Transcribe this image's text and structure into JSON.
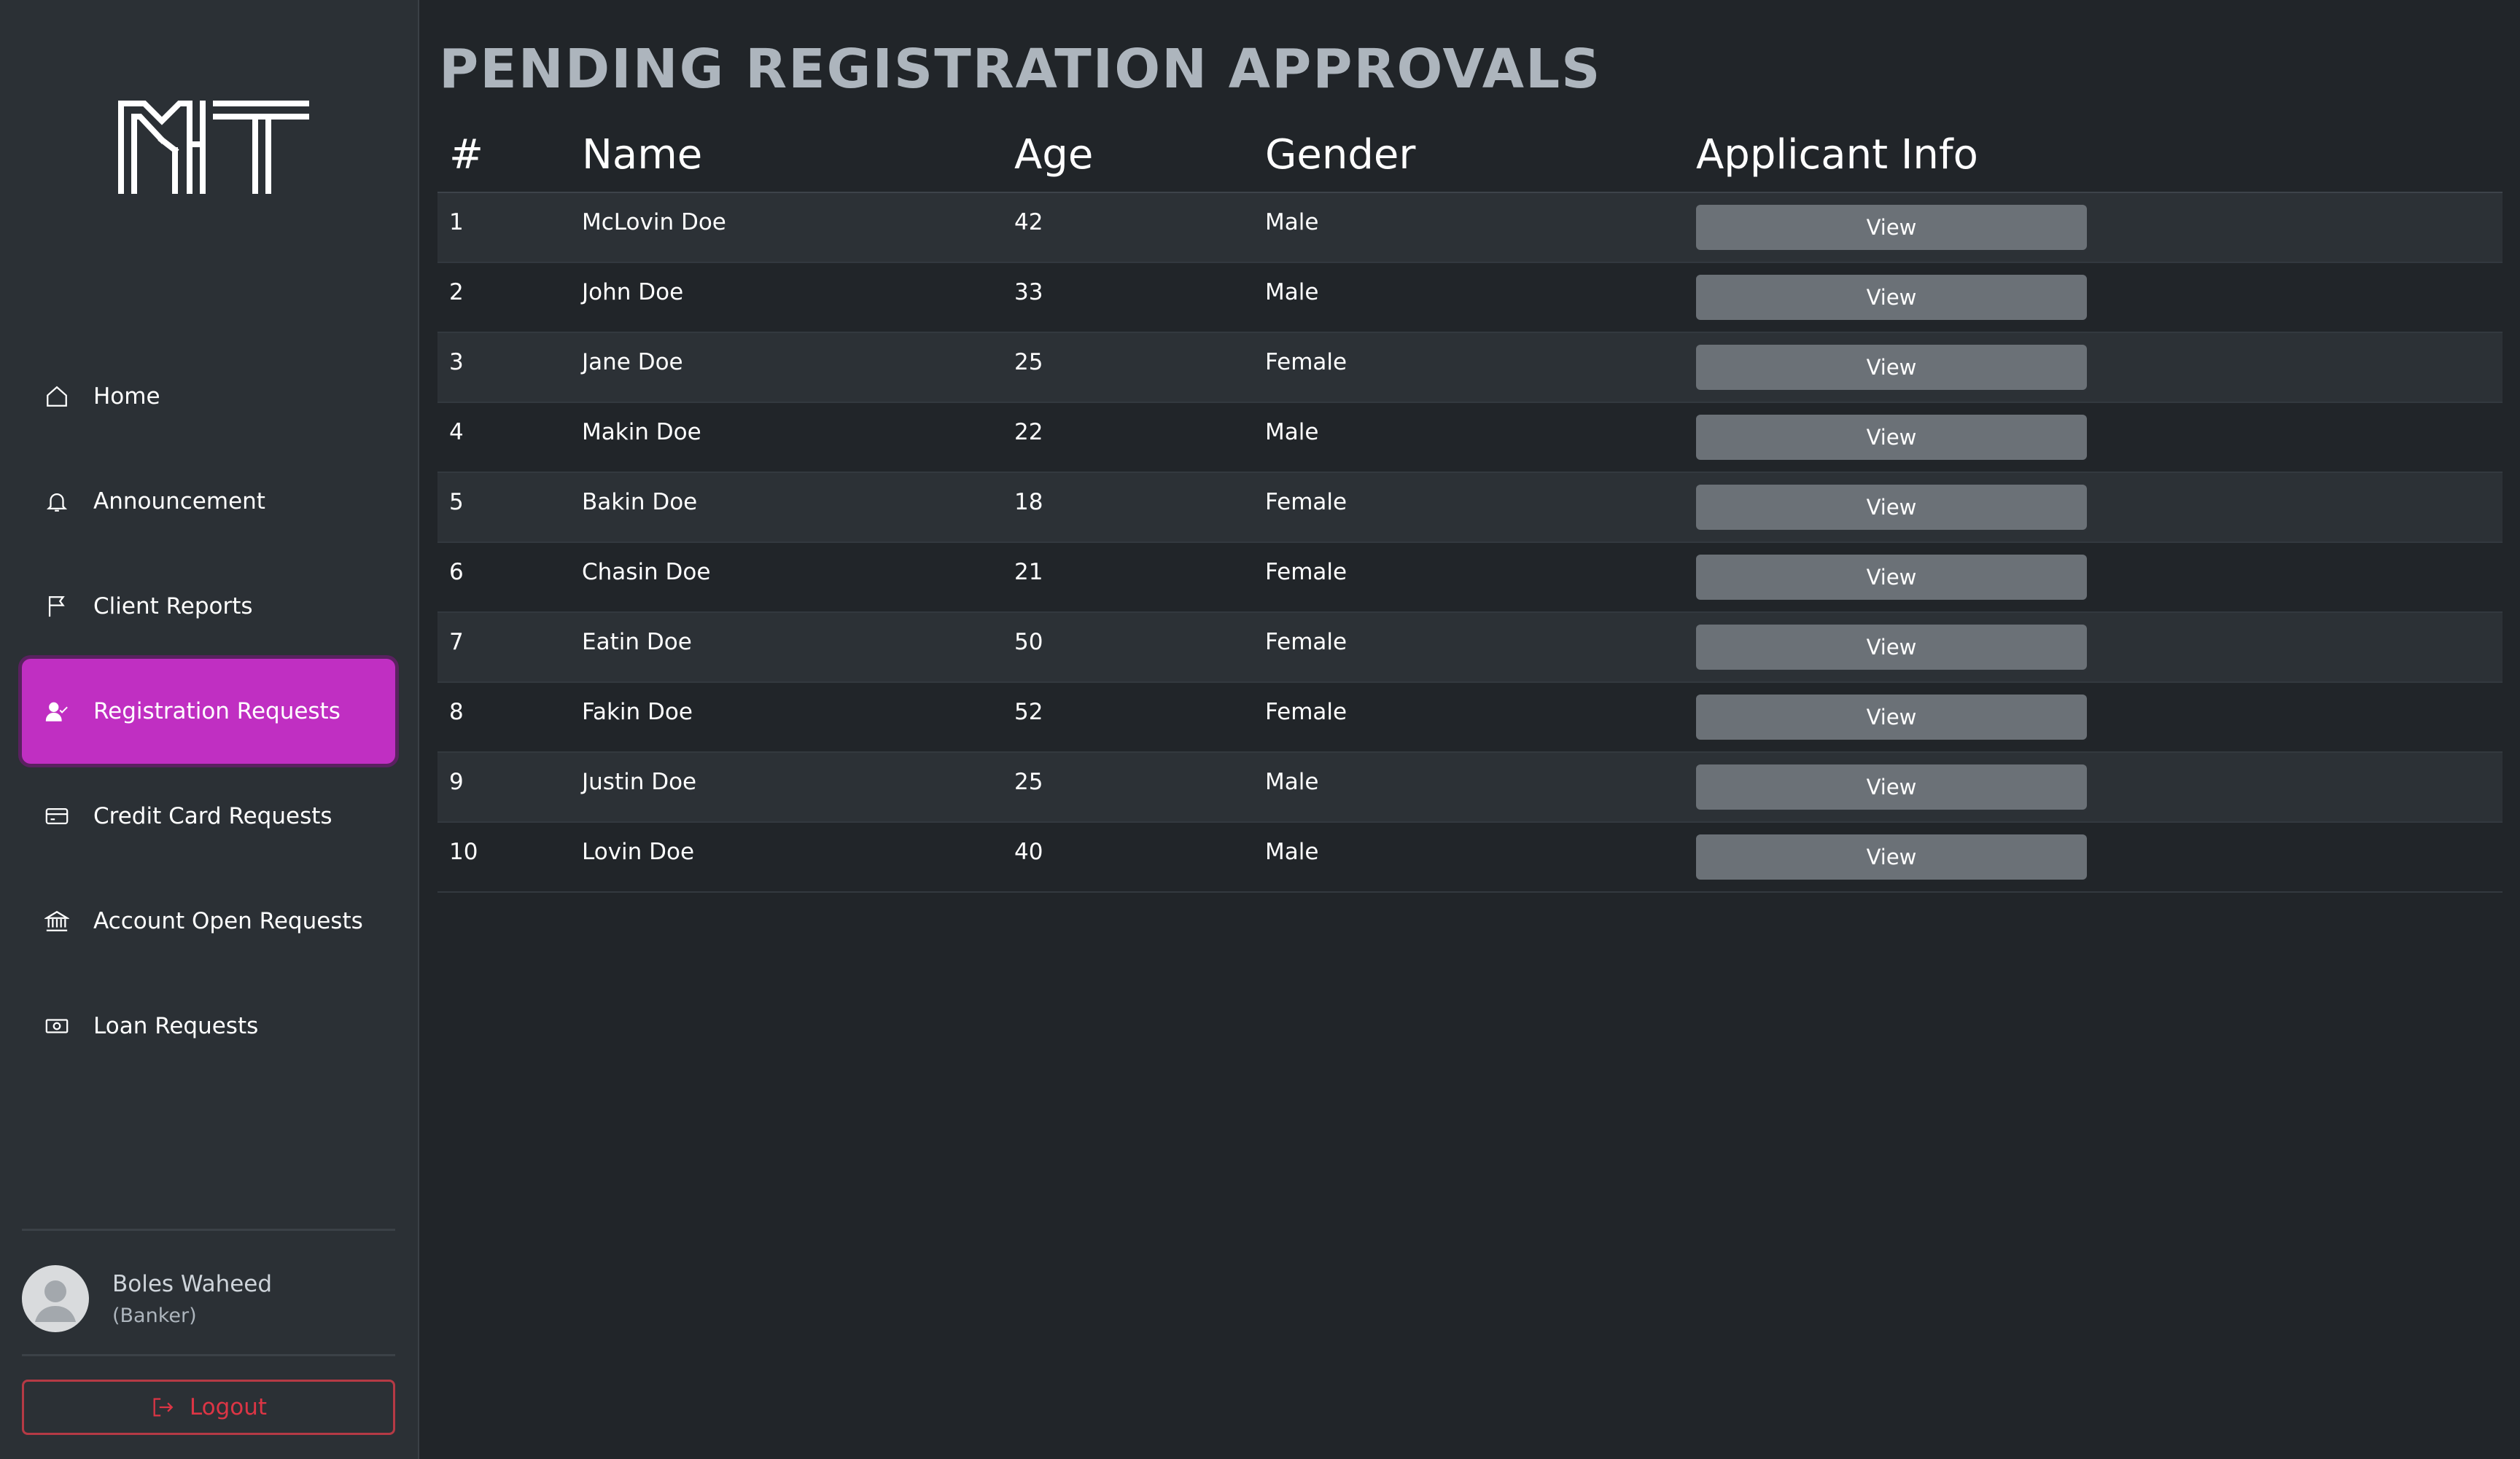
{
  "app": {
    "logo_text": "NT",
    "nav": [
      {
        "label": "Home",
        "icon": "home-icon"
      },
      {
        "label": "Announcement",
        "icon": "bell-icon"
      },
      {
        "label": "Client Reports",
        "icon": "flag-icon"
      },
      {
        "label": "Registration Requests",
        "icon": "user-check-icon",
        "active": true
      },
      {
        "label": "Credit Card Requests",
        "icon": "credit-card-icon"
      },
      {
        "label": "Account Open Requests",
        "icon": "bank-icon"
      },
      {
        "label": "Loan Requests",
        "icon": "cash-icon"
      }
    ],
    "user": {
      "name": "Boles Waheed",
      "role": "(Banker)"
    },
    "logout_label": "Logout"
  },
  "page": {
    "title": "PENDING REGISTRATION APPROVALS",
    "columns": [
      "#",
      "Name",
      "Age",
      "Gender",
      "Applicant Info"
    ],
    "view_label": "View",
    "rows": [
      {
        "idx": "1",
        "name": "McLovin Doe",
        "age": "42",
        "gender": "Male"
      },
      {
        "idx": "2",
        "name": "John Doe",
        "age": "33",
        "gender": "Male"
      },
      {
        "idx": "3",
        "name": "Jane Doe",
        "age": "25",
        "gender": "Female"
      },
      {
        "idx": "4",
        "name": "Makin Doe",
        "age": "22",
        "gender": "Male"
      },
      {
        "idx": "5",
        "name": "Bakin Doe",
        "age": "18",
        "gender": "Female"
      },
      {
        "idx": "6",
        "name": "Chasin Doe",
        "age": "21",
        "gender": "Female"
      },
      {
        "idx": "7",
        "name": "Eatin Doe",
        "age": "50",
        "gender": "Female"
      },
      {
        "idx": "8",
        "name": "Fakin Doe",
        "age": "52",
        "gender": "Female"
      },
      {
        "idx": "9",
        "name": "Justin Doe",
        "age": "25",
        "gender": "Male"
      },
      {
        "idx": "10",
        "name": "Lovin Doe",
        "age": "40",
        "gender": "Male"
      }
    ]
  },
  "colors": {
    "background": "#212529",
    "sidebar": "#2b3035",
    "accent": "#c02fc2",
    "danger": "#dc3545",
    "button": "#6b7177"
  }
}
